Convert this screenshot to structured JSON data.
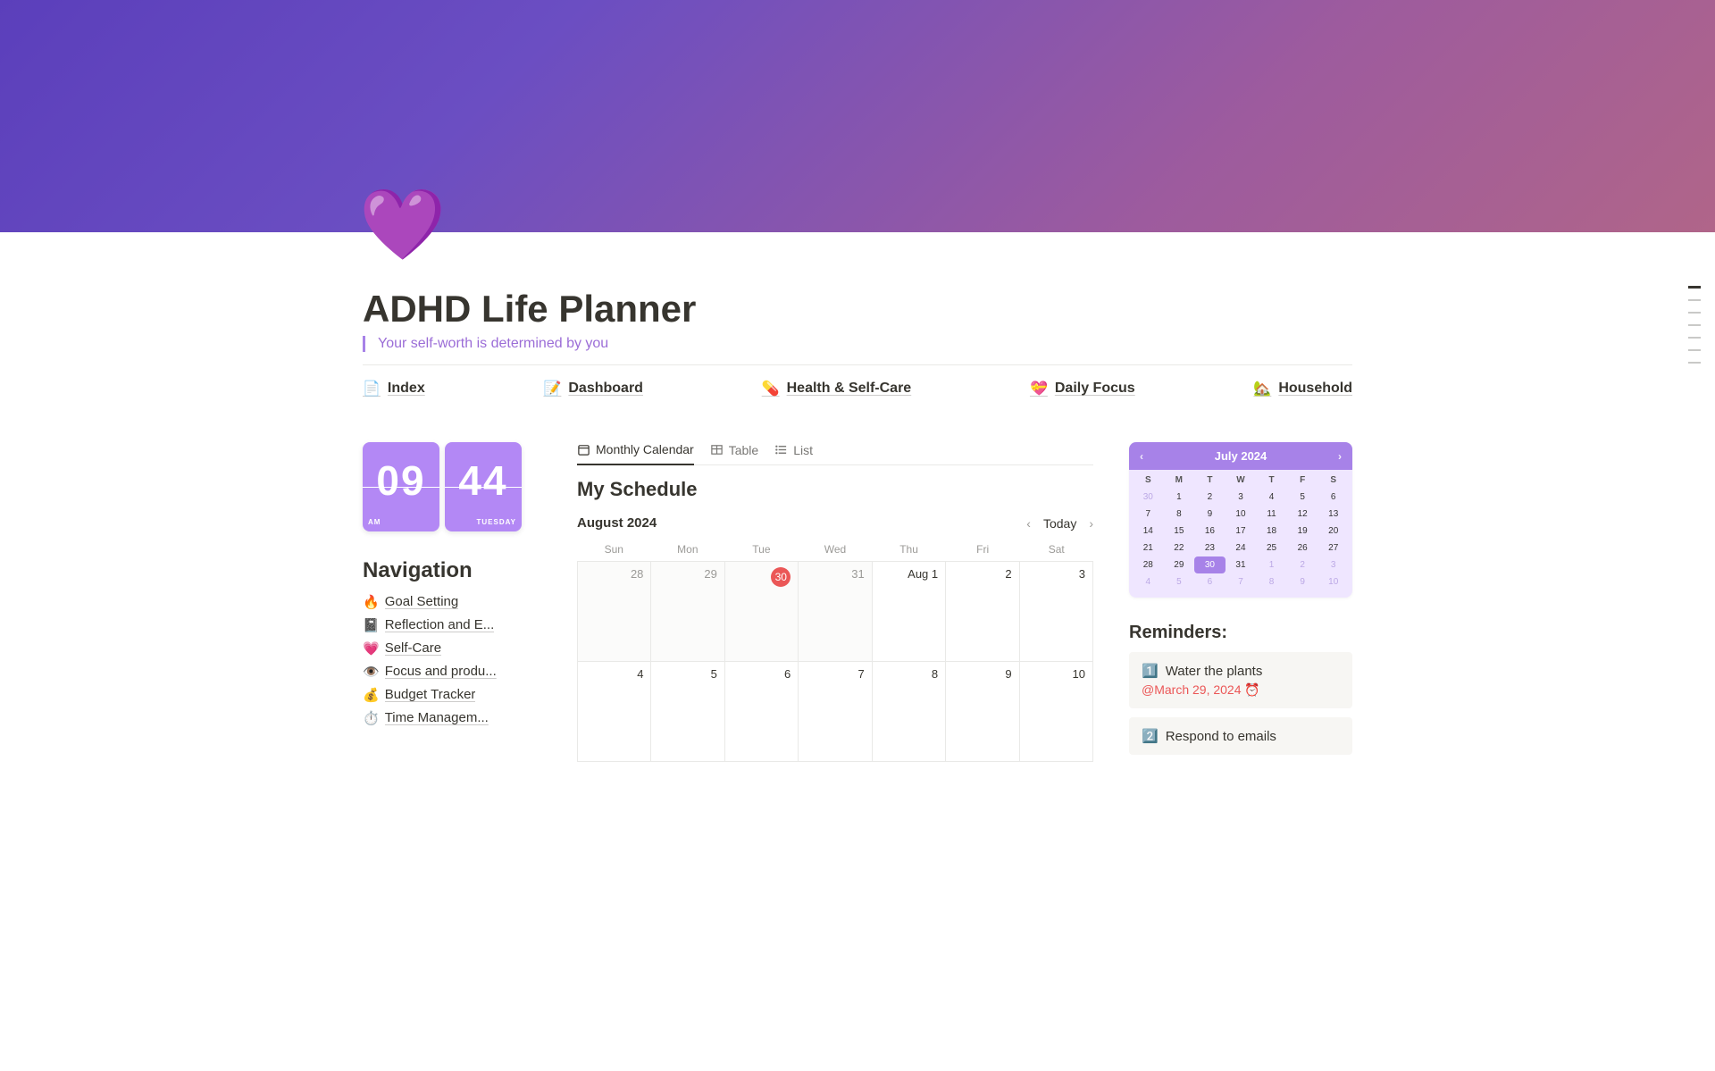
{
  "page": {
    "icon": "💜",
    "title": "ADHD Life Planner",
    "quote": "Your self-worth is determined by you"
  },
  "topnav": [
    {
      "emoji": "📄",
      "label": "Index"
    },
    {
      "emoji": "📝",
      "label": "Dashboard"
    },
    {
      "emoji": "💊",
      "label": "Health & Self-Care"
    },
    {
      "emoji": "💝",
      "label": "Daily Focus"
    },
    {
      "emoji": "🏡",
      "label": "Household"
    }
  ],
  "clock": {
    "hour": "09",
    "minute": "44",
    "ampm": "AM",
    "day": "TUESDAY"
  },
  "nav": {
    "heading": "Navigation",
    "items": [
      {
        "emoji": "🔥",
        "label": "Goal Setting"
      },
      {
        "emoji": "📓",
        "label": "Reflection and E..."
      },
      {
        "emoji": "💗",
        "label": "Self-Care"
      },
      {
        "emoji": "👁️",
        "label": "Focus and produ..."
      },
      {
        "emoji": "💰",
        "label": "Budget Tracker"
      },
      {
        "emoji": "⏱️",
        "label": "Time Managem..."
      }
    ]
  },
  "tabs": {
    "monthly": "Monthly Calendar",
    "table": "Table",
    "list": "List"
  },
  "schedule": {
    "title": "My Schedule",
    "month": "August 2024",
    "today": "Today",
    "dow": [
      "Sun",
      "Mon",
      "Tue",
      "Wed",
      "Thu",
      "Fri",
      "Sat"
    ],
    "row1": {
      "d0": "28",
      "d1": "29",
      "d2": "30",
      "d3": "31",
      "d4": "Aug 1",
      "d5": "2",
      "d6": "3"
    },
    "row2": {
      "d0": "4",
      "d1": "5",
      "d2": "6",
      "d3": "7",
      "d4": "8",
      "d5": "9",
      "d6": "10"
    }
  },
  "minical": {
    "title": "July 2024",
    "dow": [
      "S",
      "M",
      "T",
      "W",
      "T",
      "F",
      "S"
    ],
    "weeks": [
      [
        "30",
        "1",
        "2",
        "3",
        "4",
        "5",
        "6"
      ],
      [
        "7",
        "8",
        "9",
        "10",
        "11",
        "12",
        "13"
      ],
      [
        "14",
        "15",
        "16",
        "17",
        "18",
        "19",
        "20"
      ],
      [
        "21",
        "22",
        "23",
        "24",
        "25",
        "26",
        "27"
      ],
      [
        "28",
        "29",
        "30",
        "31",
        "1",
        "2",
        "3"
      ],
      [
        "4",
        "5",
        "6",
        "7",
        "8",
        "9",
        "10"
      ]
    ],
    "highlight": "30"
  },
  "reminders": {
    "heading": "Reminders:",
    "items": [
      {
        "emoji": "1️⃣",
        "text": "Water the plants",
        "date": "@March 29, 2024 ⏰"
      },
      {
        "emoji": "2️⃣",
        "text": "Respond to emails",
        "date": ""
      }
    ]
  }
}
